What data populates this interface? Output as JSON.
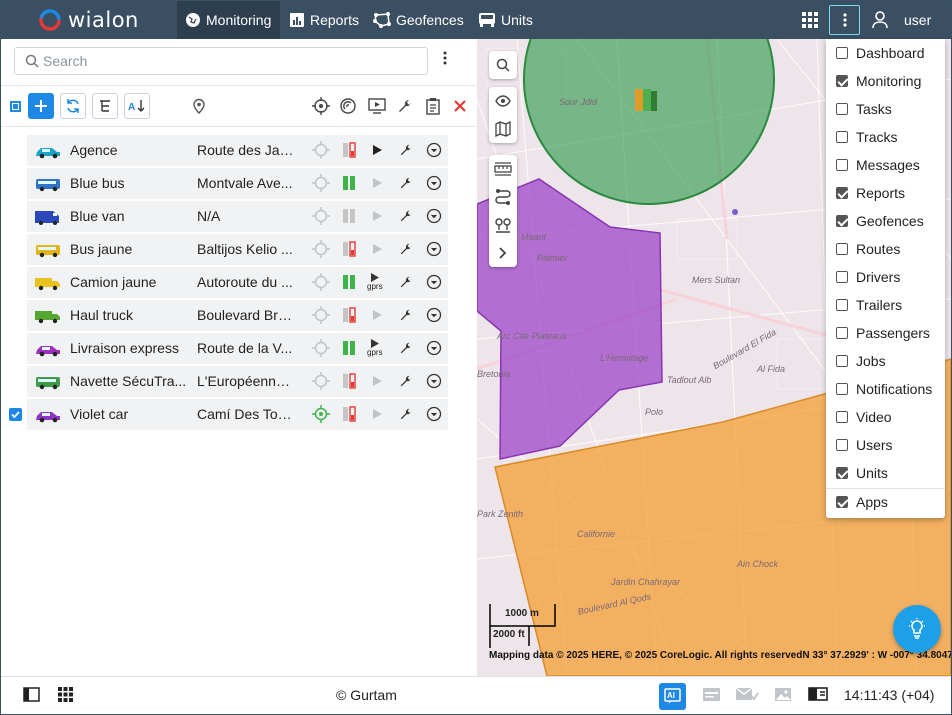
{
  "app": {
    "logo_text": "wialon",
    "user_name": "user"
  },
  "nav": {
    "monitoring": "Monitoring",
    "reports": "Reports",
    "geofences": "Geofences",
    "units": "Units"
  },
  "search": {
    "placeholder": "Search"
  },
  "units": [
    {
      "name": "Agence",
      "address": "Route des Jar...",
      "checked": false,
      "battery": "red",
      "state": "play",
      "locate_active": false,
      "icon": "car-cyan-icon"
    },
    {
      "name": "Blue bus",
      "address": "Montvale Ave...",
      "checked": false,
      "battery": "green",
      "state": "play-dim",
      "locate_active": false,
      "icon": "bus-blue-icon"
    },
    {
      "name": "Blue van",
      "address": "N/A",
      "checked": false,
      "battery": "grey",
      "state": "play-dim",
      "locate_active": false,
      "icon": "van-blue-icon"
    },
    {
      "name": "Bus jaune",
      "address": "Baltijos Kelio ...",
      "checked": false,
      "battery": "red",
      "state": "play-dim",
      "locate_active": false,
      "icon": "bus-yellow-icon"
    },
    {
      "name": "Camion jaune",
      "address": "Autoroute du ...",
      "checked": false,
      "battery": "green",
      "state": "gprs",
      "locate_active": false,
      "icon": "truck-yellow-icon"
    },
    {
      "name": "Haul truck",
      "address": "Boulevard Bra...",
      "checked": false,
      "battery": "red",
      "state": "play-dim",
      "locate_active": false,
      "icon": "truck-green-icon"
    },
    {
      "name": "Livraison express",
      "address": "Route de la V...",
      "checked": false,
      "battery": "green",
      "state": "gprs",
      "locate_active": false,
      "icon": "car-purple-icon"
    },
    {
      "name": "Navette SécuTra...",
      "address": "L'Européenne, ...",
      "checked": false,
      "battery": "red",
      "state": "play-dim",
      "locate_active": false,
      "icon": "bus-green-icon"
    },
    {
      "name": "Violet car",
      "address": "Camí Des Torr...",
      "checked": true,
      "battery": "red",
      "state": "play-dim",
      "locate_active": true,
      "icon": "car-violet-icon"
    }
  ],
  "gprs_label": "gprs",
  "map": {
    "scale_metric": "1000 m",
    "scale_imperial": "2000 ft",
    "attribution": "Mapping data © 2025 HERE, © 2025 CoreLogic. All rights reserved",
    "coordinates": "N 33° 37.2929' : W -007° 34.8047'",
    "labels": [
      "Sour Jdid",
      "Palmier",
      "Maarif",
      "Mers Sultan",
      "L'Hermitage",
      "Boulevard El Fida",
      "Al Fida",
      "Polo",
      "Park Zenith",
      "Californie",
      "Jardin Chahrayar",
      "Boulevard Al Qods",
      "Ain Chock",
      "Tadlout Alb",
      "Bretonia",
      "Arc Cité Plateaux"
    ]
  },
  "menu": {
    "items": [
      {
        "label": "Dashboard",
        "checked": false
      },
      {
        "label": "Monitoring",
        "checked": true
      },
      {
        "label": "Tasks",
        "checked": false
      },
      {
        "label": "Tracks",
        "checked": false
      },
      {
        "label": "Messages",
        "checked": false
      },
      {
        "label": "Reports",
        "checked": true
      },
      {
        "label": "Geofences",
        "checked": true
      },
      {
        "label": "Routes",
        "checked": false
      },
      {
        "label": "Drivers",
        "checked": false
      },
      {
        "label": "Trailers",
        "checked": false
      },
      {
        "label": "Passengers",
        "checked": false
      },
      {
        "label": "Jobs",
        "checked": false
      },
      {
        "label": "Notifications",
        "checked": false
      },
      {
        "label": "Video",
        "checked": false
      },
      {
        "label": "Users",
        "checked": false
      },
      {
        "label": "Units",
        "checked": true
      },
      {
        "label": "Apps",
        "checked": true
      }
    ]
  },
  "footer": {
    "copyright": "© Gurtam",
    "clock": "14:11:43 (+04)"
  },
  "colors": {
    "topbar": "#3b4f62",
    "accent": "#1e88e5",
    "geofence_green": "#2e9a4a",
    "geofence_purple": "#a24dc9",
    "geofence_orange": "#f5a23a"
  }
}
